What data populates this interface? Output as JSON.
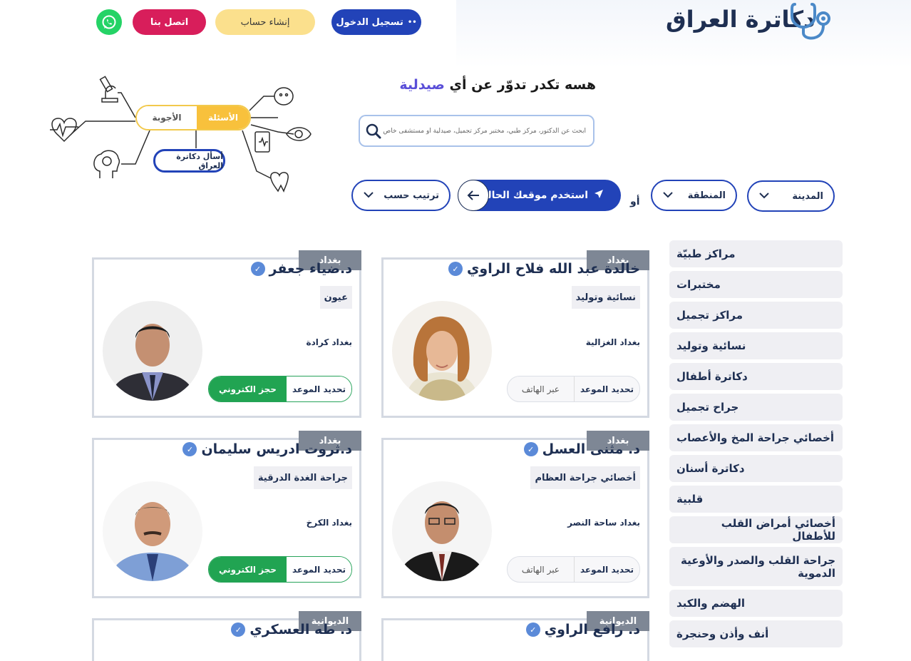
{
  "header": {
    "logo_text": "دكاترة العراق",
    "login_label": "تسجيل الدخول",
    "signup_label": "إنشاء حساب",
    "contact_label": "اتصل بنا",
    "whatsapp_icon": "whatsapp-icon"
  },
  "illustration": {
    "questions_label": "الأسئلة",
    "answers_label": "الأجوبة",
    "ask_label": "أسأل دكاترة العراق"
  },
  "search": {
    "heading_prefix": "هسه تكدر تدوّر عن أي",
    "heading_highlight": "صيدلية",
    "placeholder": "ابحث عن الدكتور، مركز طبي، مختبر مركز تجميل، صيدلية أو مستشفى خاص"
  },
  "filters": {
    "city_label": "المدينة",
    "area_label": "المنطقة",
    "or_label": "أو",
    "location_label": "استخدم موقعك الحالي",
    "sort_label": "ترتيب حسب"
  },
  "categories": [
    "مراكز طبيّة",
    "مختبرات",
    "مراكز تجميل",
    "نسائية وتوليد",
    "دكاترة أطفال",
    "جراح تجميل",
    "أخصائي جراحة المخ والأعصاب",
    "دكاترة أسنان",
    "قلبية",
    "أخصائي أمراض القلب للأطفال",
    "جراحة القلب والصدر والأوعية الدموية",
    "الهضم والكبد",
    "أنف وأذن وحنجرة"
  ],
  "doctors": [
    {
      "name": "خالدة عبد الله فلاح الراوي",
      "city": "بغداد",
      "specialty": "نسائية وتوليد",
      "location": "بغداد الغزالية",
      "book_label": "تحديد الموعد",
      "book_method": "عبر الهاتف"
    },
    {
      "name": "د.ضياء جعفر",
      "city": "بغداد",
      "specialty": "عيون",
      "location": "بغداد كرادة",
      "book_label": "تحديد الموعد",
      "book_method": "حجز الكتروني"
    },
    {
      "name": "د. مثنى العسل",
      "city": "بغداد",
      "specialty": "أخصائي جراحة العظام",
      "location": "بغداد ساحة النصر",
      "book_label": "تحديد الموعد",
      "book_method": "عبر الهاتف"
    },
    {
      "name": "د.ثروت ادريس سليمان",
      "city": "بغداد",
      "specialty": "جراحة الغدة الدرقية",
      "location": "بغداد الكرخ",
      "book_label": "تحديد الموعد",
      "book_method": "حجز الكتروني"
    },
    {
      "name": "د. رافع الراوي",
      "city": "الديوانية"
    },
    {
      "name": "د. طه العسكري",
      "city": "الديوانية"
    }
  ],
  "colors": {
    "primary": "#2243b8",
    "accent_yellow": "#f8c13c",
    "contact_red": "#d81e5b",
    "whatsapp_green": "#25d366",
    "booking_green": "#21a452"
  }
}
